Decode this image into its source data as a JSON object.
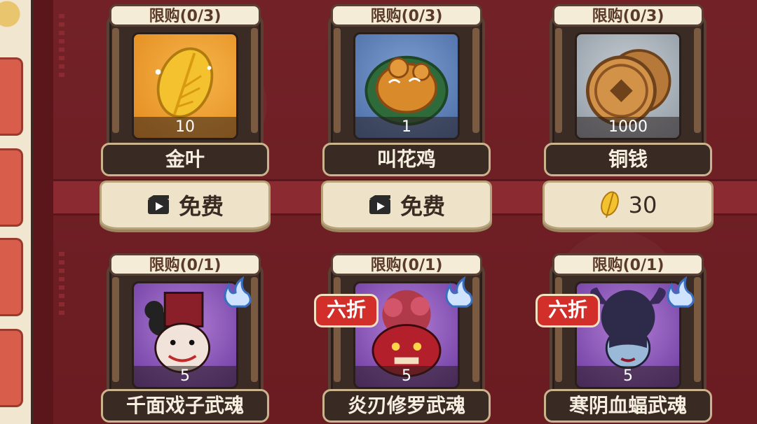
{
  "shop": {
    "row1": [
      {
        "limit": "限购(0/3)",
        "qty": "10",
        "name": "金叶",
        "price_type": "free",
        "price_label": "免费",
        "bg": "orange",
        "icon": "gold-leaf-icon"
      },
      {
        "limit": "限购(0/3)",
        "qty": "1",
        "name": "叫花鸡",
        "price_type": "free",
        "price_label": "免费",
        "bg": "blue",
        "icon": "roast-chicken-icon"
      },
      {
        "limit": "限购(0/3)",
        "qty": "1000",
        "name": "铜钱",
        "price_type": "leaf",
        "price_label": "30",
        "bg": "gray",
        "icon": "copper-coin-icon"
      }
    ],
    "row2": [
      {
        "limit": "限购(0/1)",
        "qty": "5",
        "name": "千面戏子武魂",
        "bg": "purple",
        "icon": "opera-warrior-portrait",
        "sale": ""
      },
      {
        "limit": "限购(0/1)",
        "qty": "5",
        "name": "炎刃修罗武魂",
        "bg": "purple",
        "icon": "flame-asura-portrait",
        "sale": "六折"
      },
      {
        "limit": "限购(0/1)",
        "qty": "5",
        "name": "寒阴血蝠武魂",
        "bg": "purple",
        "icon": "blood-bat-portrait",
        "sale": "六折"
      }
    ]
  },
  "colors": {
    "background": "#6e1f24",
    "sale_red": "#d22f2a",
    "gold": "#f3c22e"
  }
}
